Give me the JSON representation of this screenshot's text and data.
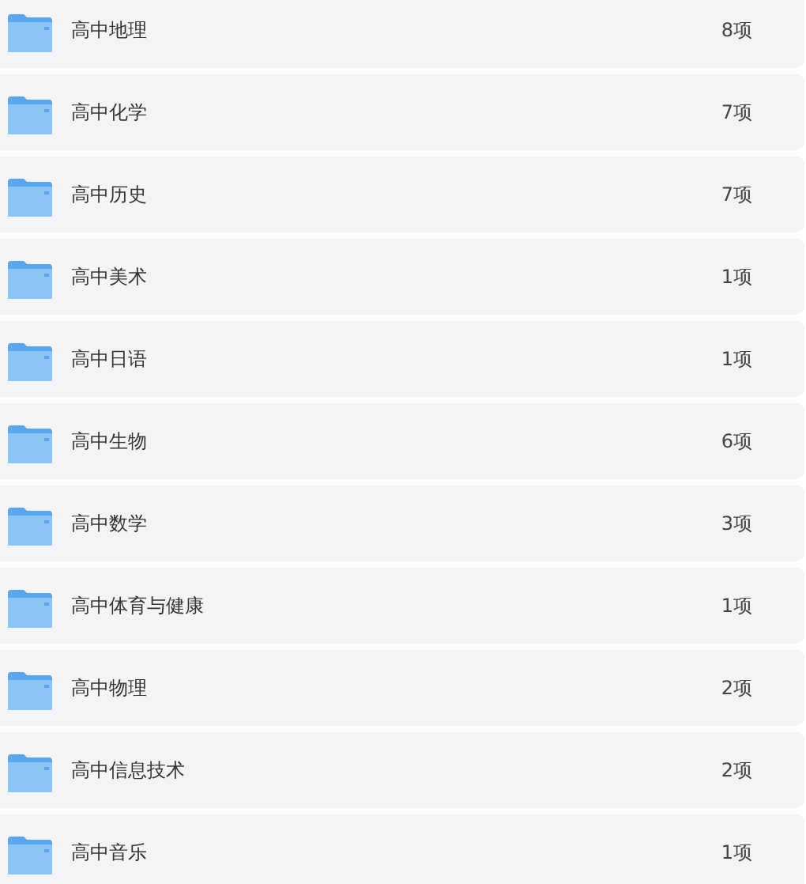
{
  "folders": [
    {
      "name": "高中地理",
      "count": "8项"
    },
    {
      "name": "高中化学",
      "count": "7项"
    },
    {
      "name": "高中历史",
      "count": "7项"
    },
    {
      "name": "高中美术",
      "count": "1项"
    },
    {
      "name": "高中日语",
      "count": "1项"
    },
    {
      "name": "高中生物",
      "count": "6项"
    },
    {
      "name": "高中数学",
      "count": "3项"
    },
    {
      "name": "高中体育与健康",
      "count": "1项"
    },
    {
      "name": "高中物理",
      "count": "2项"
    },
    {
      "name": "高中信息技术",
      "count": "2项"
    },
    {
      "name": "高中音乐",
      "count": "1项"
    }
  ]
}
